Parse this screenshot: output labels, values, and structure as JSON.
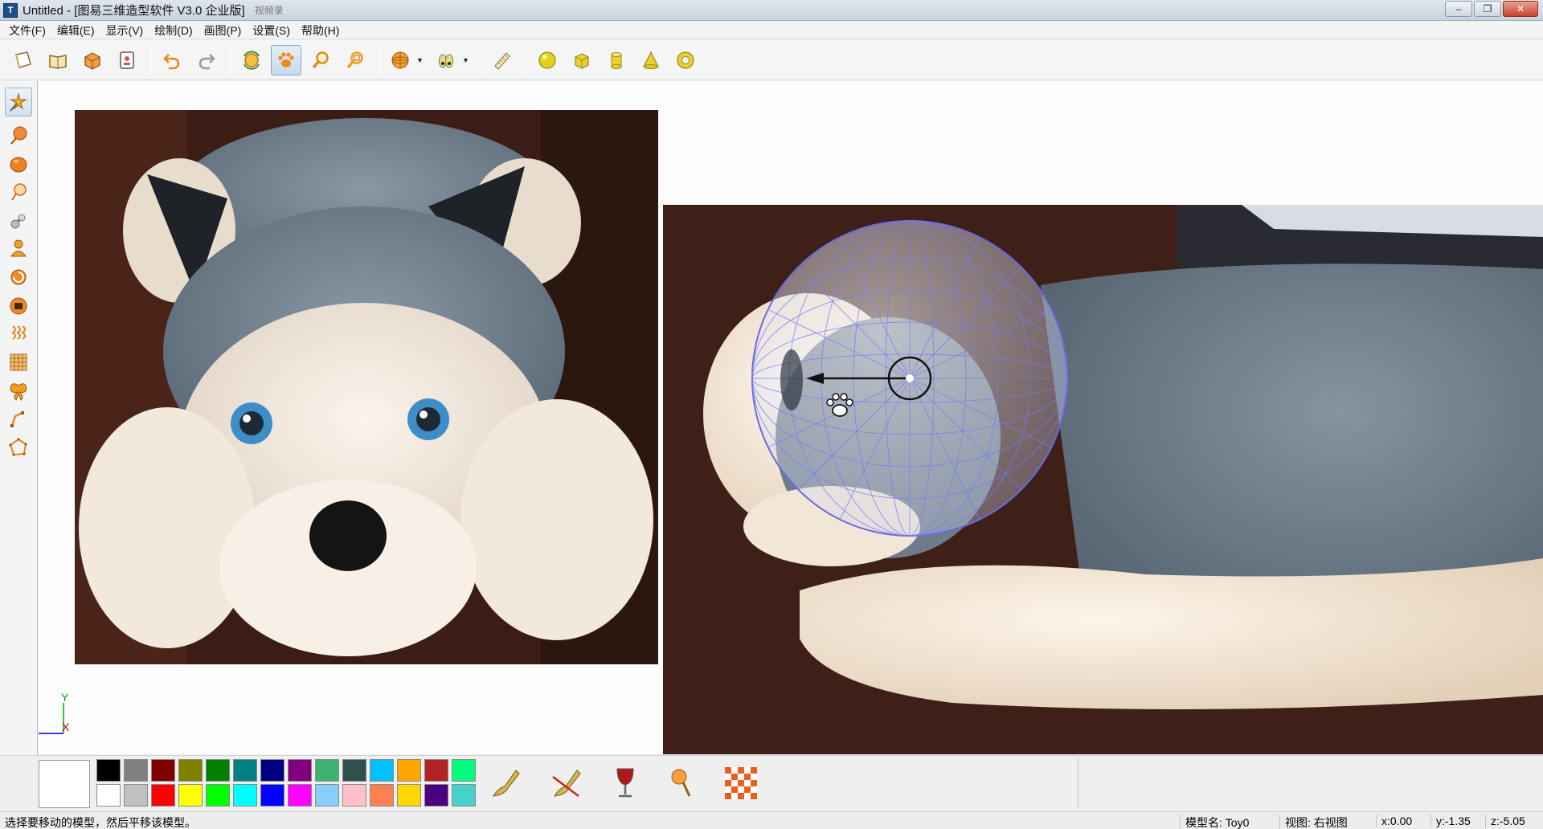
{
  "window": {
    "title": "Untitled - [图易三维造型软件 V3.0 企业版]",
    "faded_suffix": "视频录",
    "controls": {
      "minimize": "–",
      "maximize": "❐",
      "close": "✕"
    }
  },
  "menu": [
    "文件(F)",
    "编辑(E)",
    "显示(V)",
    "绘制(D)",
    "画图(P)",
    "设置(S)",
    "帮助(H)"
  ],
  "toolbar": {
    "buttons": [
      {
        "name": "new-file",
        "icon": "new-page-icon"
      },
      {
        "name": "open-file",
        "icon": "open-book-icon"
      },
      {
        "name": "save-file",
        "icon": "save-box-icon"
      },
      {
        "name": "export",
        "icon": "export-icon"
      },
      {
        "name": "undo",
        "icon": "undo-icon"
      },
      {
        "name": "redo",
        "icon": "redo-icon"
      },
      {
        "name": "rotate-view",
        "icon": "rotate-icon"
      },
      {
        "name": "pan-view",
        "icon": "paw-icon",
        "active": true
      },
      {
        "name": "zoom-in",
        "icon": "zoom-in-icon"
      },
      {
        "name": "zoom-window",
        "icon": "zoom-window-icon"
      },
      {
        "name": "render-mode",
        "icon": "sphere-shade-icon",
        "dropdown": true
      },
      {
        "name": "view-mode",
        "icon": "eyes-icon",
        "dropdown": true
      },
      {
        "name": "measure",
        "icon": "ruler-icon"
      },
      {
        "name": "sphere",
        "icon": "sphere-icon"
      },
      {
        "name": "cube",
        "icon": "cube-icon"
      },
      {
        "name": "cylinder",
        "icon": "cylinder-icon"
      },
      {
        "name": "cone",
        "icon": "cone-icon"
      },
      {
        "name": "torus",
        "icon": "torus-icon"
      }
    ]
  },
  "left_tools": [
    "magic-wand-icon",
    "balloon-icon",
    "ellipse-icon",
    "lasso-icon",
    "bone-icon",
    "person-icon",
    "rotate-tool-icon",
    "frame-icon",
    "spring-icon",
    "grid-icon",
    "butterfly-icon",
    "path-icon",
    "polygon-icon"
  ],
  "axis": {
    "y_label": "Y",
    "x_label": "X"
  },
  "palette": {
    "top_row": [
      "#000000",
      "#808080",
      "#800000",
      "#808000",
      "#008000",
      "#008080",
      "#000080",
      "#800080",
      "#3cb371",
      "#2f4f4f",
      "#00bfff",
      "#ffa500",
      "#b22222",
      "#00ff7f"
    ],
    "bottom_row": [
      "#ffffff",
      "#c0c0c0",
      "#ff0000",
      "#ffff00",
      "#00ff00",
      "#00ffff",
      "#0000ff",
      "#ff00ff",
      "#87cefa",
      "#ffc0cb",
      "#ff7f50",
      "#ffd700",
      "#4b0082",
      "#48d1cc"
    ],
    "tools": [
      "brush-icon",
      "eraser-brush-icon",
      "wine-glass-icon",
      "spray-icon",
      "checkerboard-icon"
    ]
  },
  "status": {
    "message": "选择要移动的模型，然后平移该模型。",
    "model_name": "模型名: Toy0",
    "view": "视图: 右视图",
    "x": "x:0.00",
    "y": "y:-1.35",
    "z": "z:-5.05"
  }
}
